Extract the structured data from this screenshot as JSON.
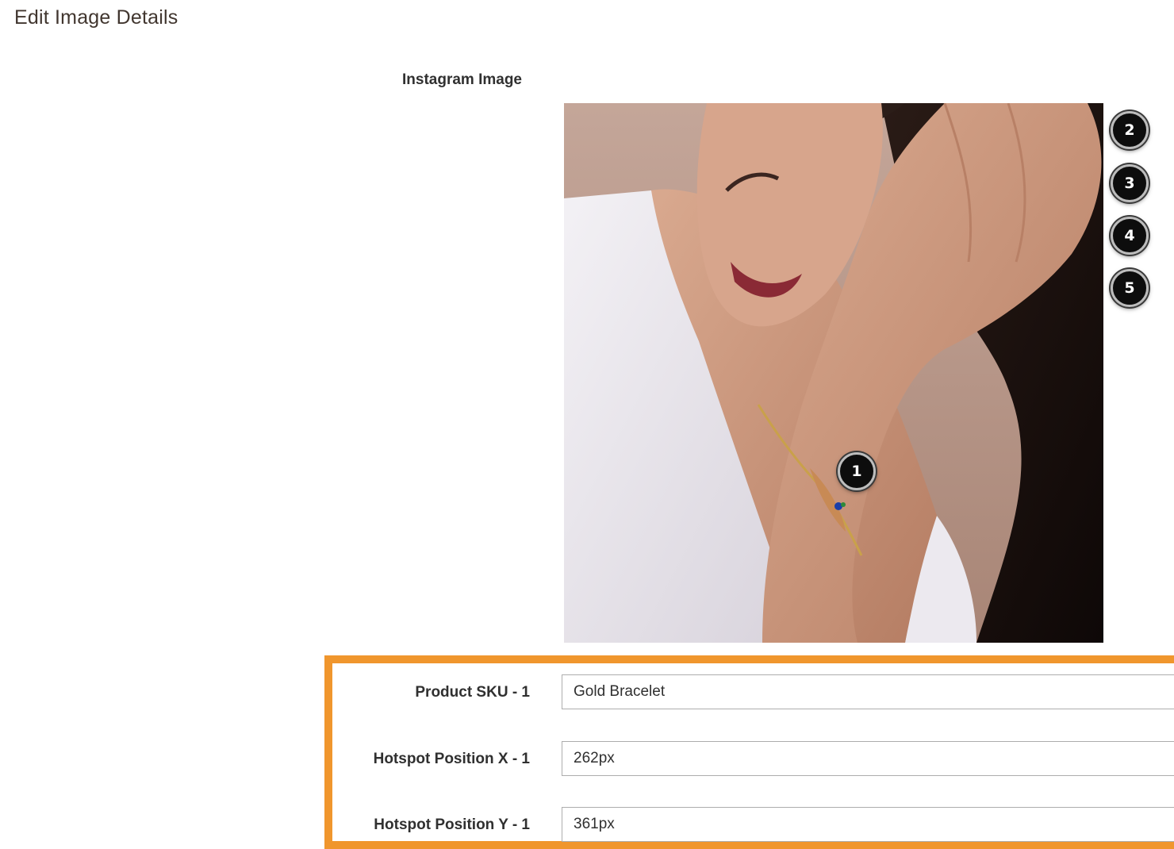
{
  "page": {
    "title": "Edit Image Details"
  },
  "image_section": {
    "label": "Instagram Image",
    "image_description_icon": "photo-of-woman-wearing-gold-bracelet",
    "hotspots": [
      {
        "number": "1"
      },
      {
        "number": "2"
      },
      {
        "number": "3"
      },
      {
        "number": "4"
      },
      {
        "number": "5"
      }
    ]
  },
  "fields": [
    {
      "label": "Product SKU - 1",
      "value": "Gold Bracelet"
    },
    {
      "label": "Hotspot Position X - 1",
      "value": "262px"
    },
    {
      "label": "Hotspot Position Y - 1",
      "value": "361px"
    }
  ],
  "colors": {
    "highlight": "#f0962d",
    "title_text": "#41362f",
    "hotspot_bg": "#0d0d0d"
  }
}
